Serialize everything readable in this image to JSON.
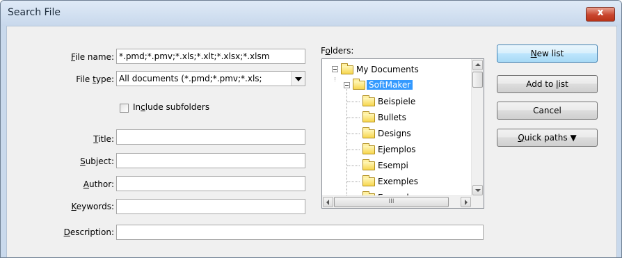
{
  "window": {
    "title": "Search File",
    "close_glyph": "x"
  },
  "colors": {
    "titlebar": "#c8d8ec",
    "close_button": "#c9462f",
    "selection": "#3399ff",
    "folder_fill": "#f7d64f"
  },
  "form": {
    "file_name": {
      "label_prefix": "",
      "label_key": "F",
      "label_rest": "ile name:",
      "value": "*.pmd;*.pmv;*.xls;*.xlt;*.xlsx;*.xlsm"
    },
    "file_type": {
      "label_prefix": "File ",
      "label_key": "t",
      "label_rest": "ype:",
      "value": "All documents (*.pmd;*.pmv;*.xls;"
    },
    "include_subfolders": {
      "label_prefix": "In",
      "label_key": "c",
      "label_rest": "lude subfolders",
      "checked": false
    },
    "title": {
      "label_prefix": "",
      "label_key": "T",
      "label_rest": "itle:",
      "value": ""
    },
    "subject": {
      "label_prefix": "",
      "label_key": "S",
      "label_rest": "ubject:",
      "value": ""
    },
    "author": {
      "label_prefix": "",
      "label_key": "A",
      "label_rest": "uthor:",
      "value": ""
    },
    "keywords": {
      "label_prefix": "",
      "label_key": "K",
      "label_rest": "eywords:",
      "value": ""
    },
    "description": {
      "label_prefix": "",
      "label_key": "D",
      "label_rest": "escription:",
      "value": ""
    }
  },
  "folders": {
    "label_prefix": "F",
    "label_key": "o",
    "label_rest": "lders:",
    "root": "My Documents",
    "selected": "SoftMaker",
    "children": [
      "Beispiele",
      "Bullets",
      "Designs",
      "Ejemplos",
      "Esempi",
      "Exemples",
      "Exampl"
    ],
    "hscroll_grip": "III"
  },
  "buttons": {
    "new_list": {
      "prefix": "",
      "key": "N",
      "rest": "ew list"
    },
    "add_to_list": {
      "prefix": "Add to ",
      "key": "l",
      "rest": "ist"
    },
    "cancel": {
      "prefix": "Cancel",
      "key": "",
      "rest": ""
    },
    "quick_paths": {
      "prefix": "",
      "key": "Q",
      "rest": "uick paths",
      "arrow": "▼"
    }
  }
}
